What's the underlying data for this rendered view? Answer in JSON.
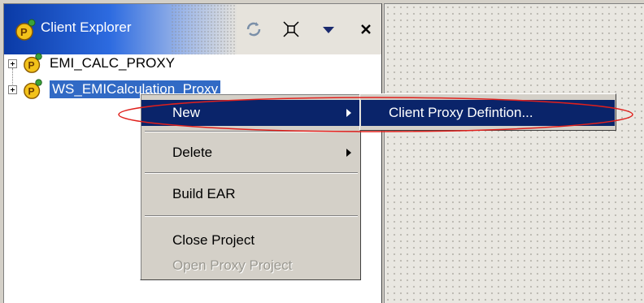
{
  "explorer": {
    "title": "Client Explorer",
    "toolbar_icons": [
      "refresh-icon",
      "collapse-all-icon",
      "view-menu-icon",
      "close-icon"
    ]
  },
  "tree": {
    "items": [
      {
        "label": "EMI_CALC_PROXY",
        "selected": false
      },
      {
        "label": "WS_EMICalculation_Proxy",
        "selected": true
      }
    ]
  },
  "context_menu": {
    "items": [
      {
        "label": "New",
        "submenu": true,
        "active": true
      },
      {
        "label": "Delete",
        "submenu": true
      },
      {
        "label": "Build EAR"
      },
      {
        "label": "Close Project"
      },
      {
        "label": "Open Proxy Project",
        "disabled": true
      }
    ],
    "submenu": {
      "label": "Client Proxy Defintion..."
    }
  },
  "colors": {
    "selection": "#316ac5",
    "menu_highlight": "#0a246a",
    "annotation": "#e0201c"
  }
}
